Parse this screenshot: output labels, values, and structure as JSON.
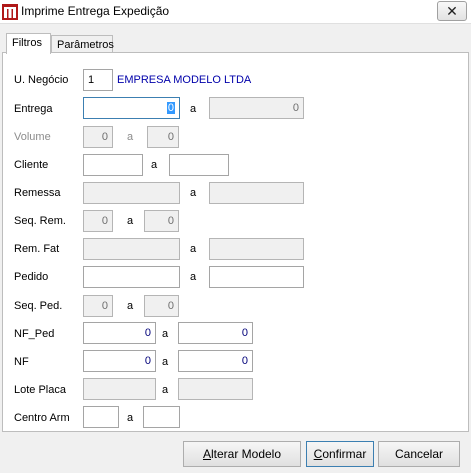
{
  "window": {
    "title": "Imprime Entrega Expedição",
    "close_glyph": "✕"
  },
  "tabs": [
    {
      "label": "Filtros"
    },
    {
      "label": "Parâmetros"
    }
  ],
  "form": {
    "business_unit": {
      "label": "U. Negócio",
      "value": "1",
      "company": "EMPRESA MODELO LTDA"
    },
    "entrega": {
      "label": "Entrega",
      "from": "0",
      "sep": "a",
      "to": "0"
    },
    "volume": {
      "label": "Volume",
      "from": "0",
      "sep": "a",
      "to": "0"
    },
    "cliente": {
      "label": "Cliente",
      "from": "",
      "sep": "a",
      "to": ""
    },
    "remessa": {
      "label": "Remessa",
      "from": "",
      "sep": "a",
      "to": ""
    },
    "seq_rem": {
      "label": "Seq. Rem.",
      "from": "0",
      "sep": "a",
      "to": "0"
    },
    "rem_fat": {
      "label": "Rem. Fat",
      "from": "",
      "sep": "a",
      "to": ""
    },
    "pedido": {
      "label": "Pedido",
      "from": "",
      "sep": "a",
      "to": ""
    },
    "seq_ped": {
      "label": "Seq. Ped.",
      "from": "0",
      "sep": "a",
      "to": "0"
    },
    "nf_ped": {
      "label": "NF_Ped",
      "from": "0",
      "sep": "a",
      "to": "0"
    },
    "nf": {
      "label": "NF",
      "from": "0",
      "sep": "a",
      "to": "0"
    },
    "lote_placa": {
      "label": "Lote Placa",
      "from": "",
      "sep": "a",
      "to": ""
    },
    "centro_arm": {
      "label": "Centro Arm",
      "from": "",
      "sep": "a",
      "to": ""
    }
  },
  "buttons": {
    "alterar": {
      "mnemonic": "A",
      "rest": "lterar Modelo"
    },
    "confirmar": {
      "mnemonic": "C",
      "rest": "onfirmar"
    },
    "cancelar": {
      "mnemonic": "",
      "rest": "Cancelar"
    }
  },
  "colors": {
    "value_text": "#00007a",
    "company_text": "#0000aa",
    "focus_border": "#3c7fb1",
    "selection": "#3399ff"
  }
}
